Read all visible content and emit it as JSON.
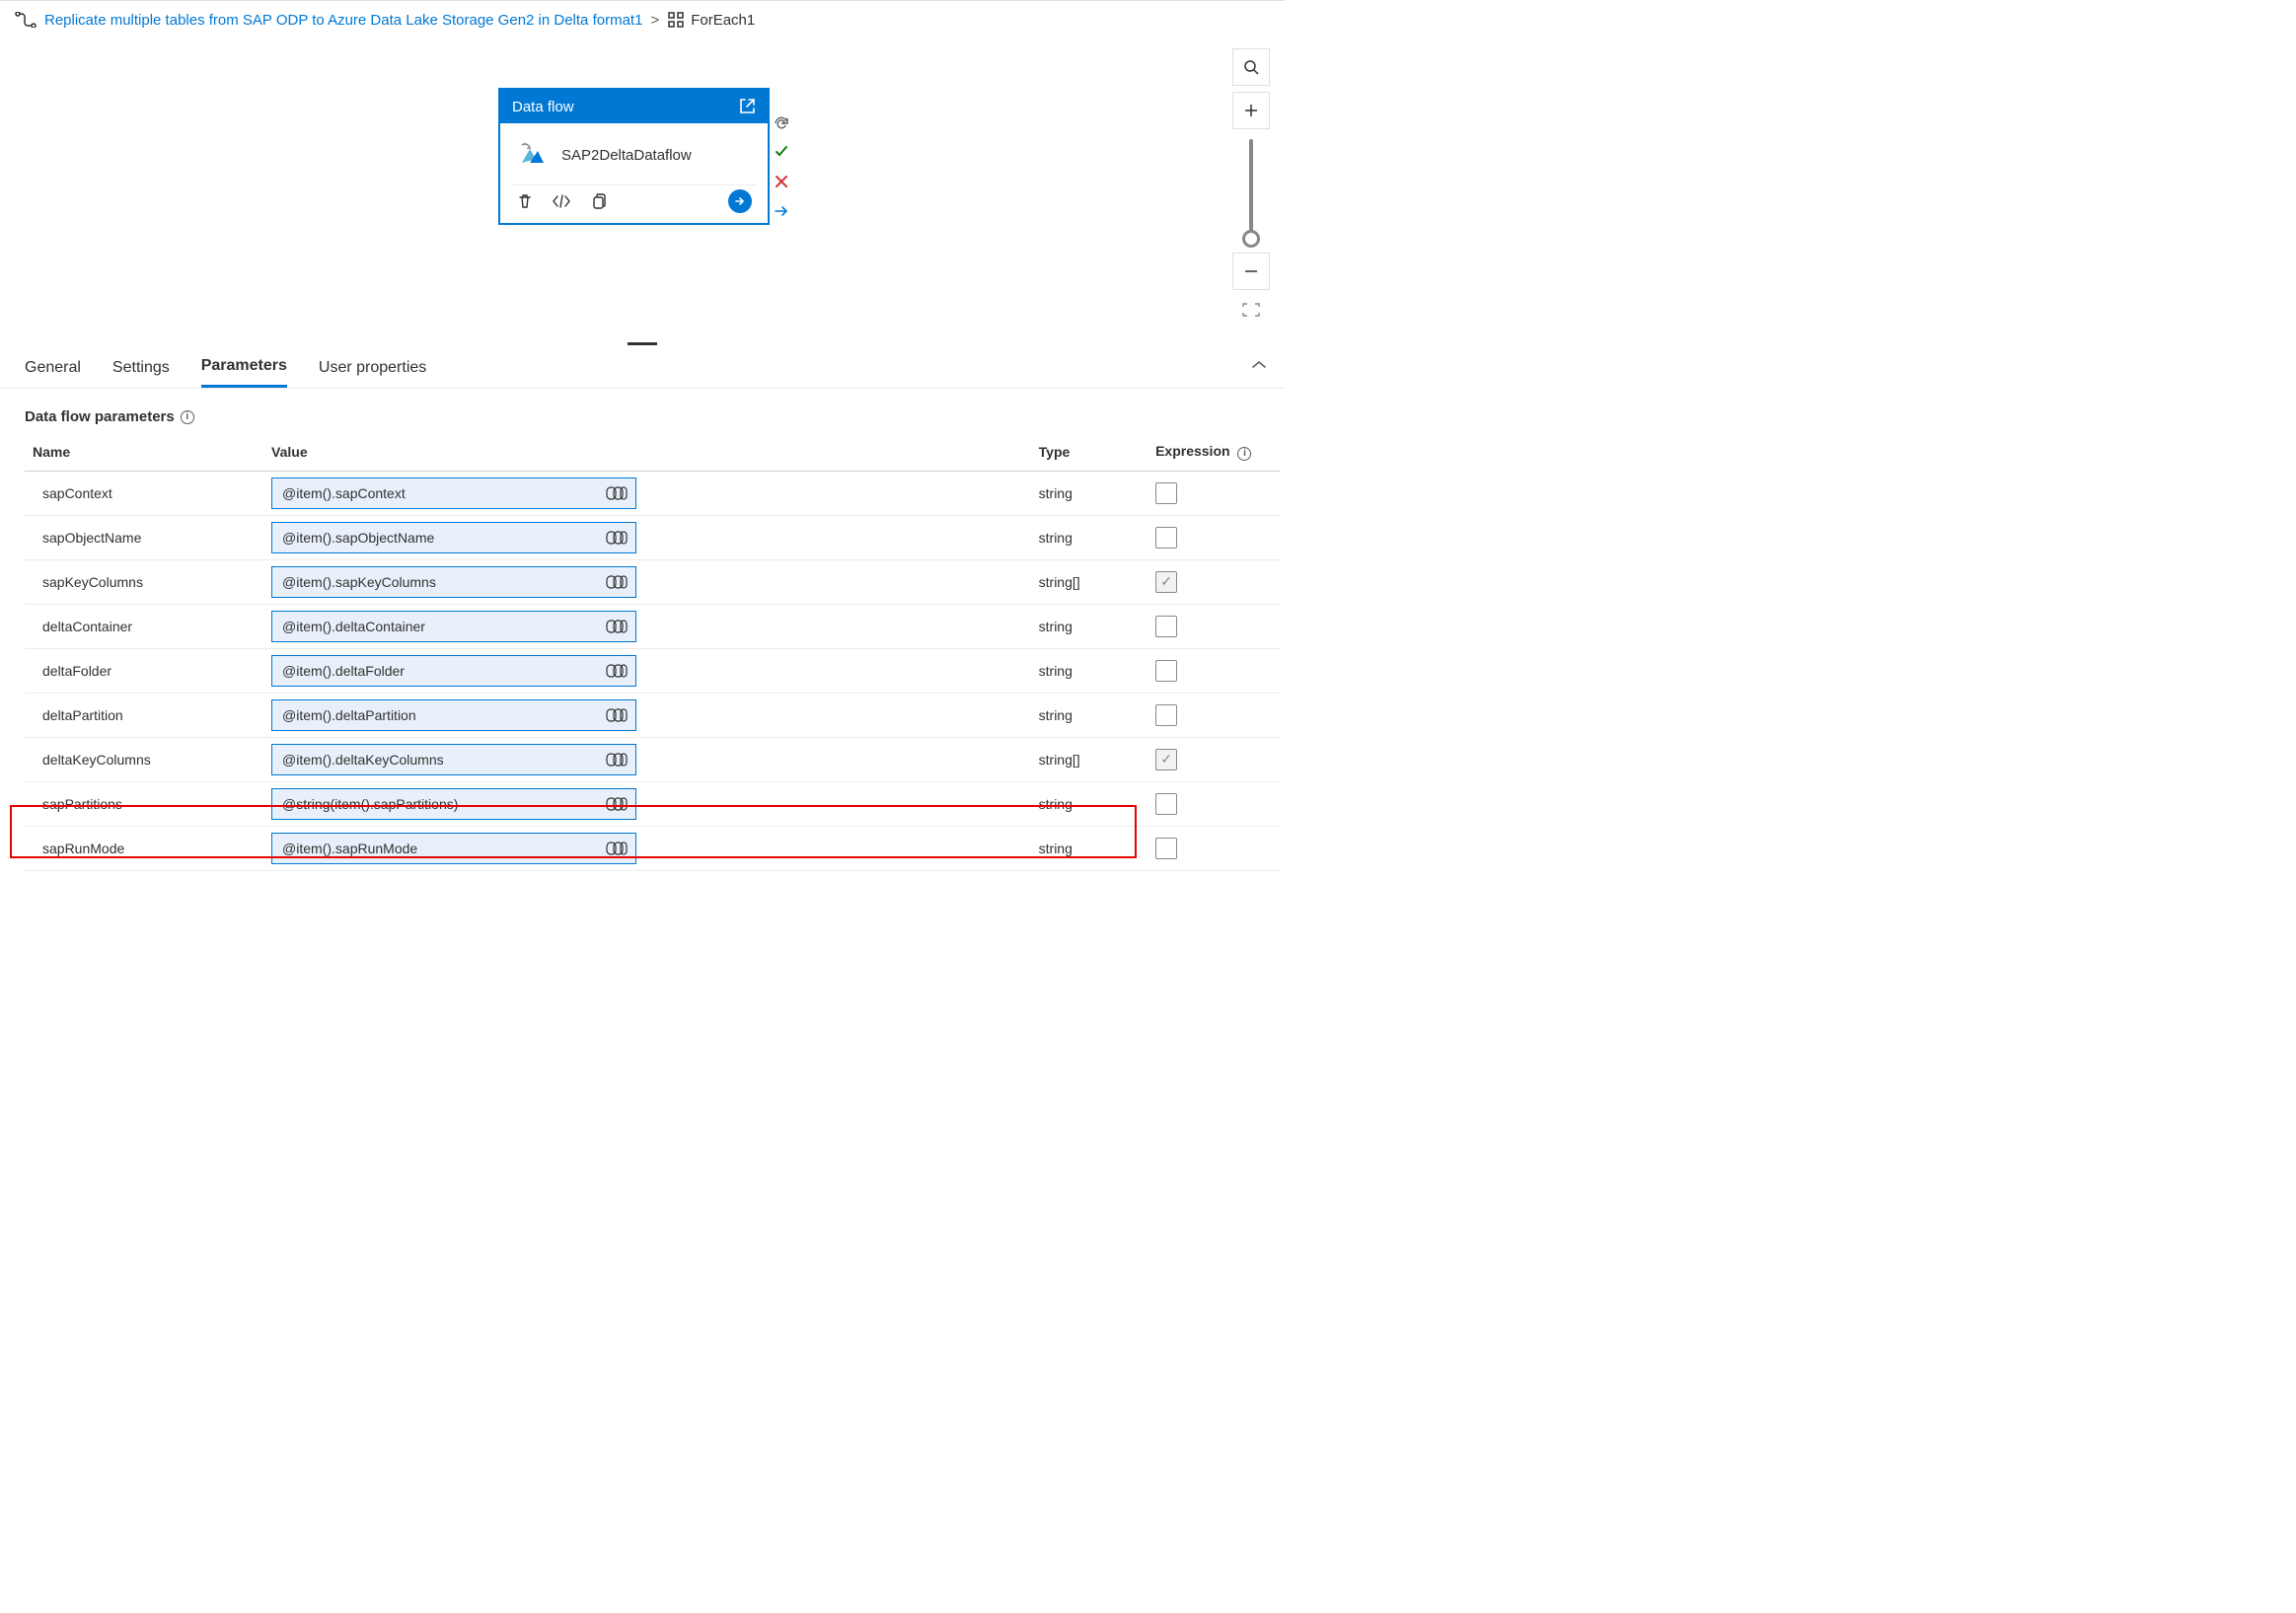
{
  "breadcrumb": {
    "parent": "Replicate multiple tables from SAP ODP to Azure Data Lake Storage Gen2 in Delta format1",
    "current": "ForEach1"
  },
  "activity": {
    "type_label": "Data flow",
    "name": "SAP2DeltaDataflow"
  },
  "tabs": {
    "general": "General",
    "settings": "Settings",
    "parameters": "Parameters",
    "user_props": "User properties"
  },
  "section": {
    "heading": "Data flow parameters"
  },
  "table": {
    "headers": {
      "name": "Name",
      "value": "Value",
      "type": "Type",
      "expr": "Expression"
    },
    "rows": [
      {
        "name": "sapContext",
        "value": "@item().sapContext",
        "type": "string",
        "checked": false,
        "disabled": false
      },
      {
        "name": "sapObjectName",
        "value": "@item().sapObjectName",
        "type": "string",
        "checked": false,
        "disabled": false
      },
      {
        "name": "sapKeyColumns",
        "value": "@item().sapKeyColumns",
        "type": "string[]",
        "checked": true,
        "disabled": true
      },
      {
        "name": "deltaContainer",
        "value": "@item().deltaContainer",
        "type": "string",
        "checked": false,
        "disabled": false
      },
      {
        "name": "deltaFolder",
        "value": "@item().deltaFolder",
        "type": "string",
        "checked": false,
        "disabled": false
      },
      {
        "name": "deltaPartition",
        "value": "@item().deltaPartition",
        "type": "string",
        "checked": false,
        "disabled": false
      },
      {
        "name": "deltaKeyColumns",
        "value": "@item().deltaKeyColumns",
        "type": "string[]",
        "checked": true,
        "disabled": true
      },
      {
        "name": "sapPartitions",
        "value": "@string(item().sapPartitions)",
        "type": "string",
        "checked": false,
        "disabled": false
      },
      {
        "name": "sapRunMode",
        "value": "@item().sapRunMode",
        "type": "string",
        "checked": false,
        "disabled": false
      }
    ]
  }
}
